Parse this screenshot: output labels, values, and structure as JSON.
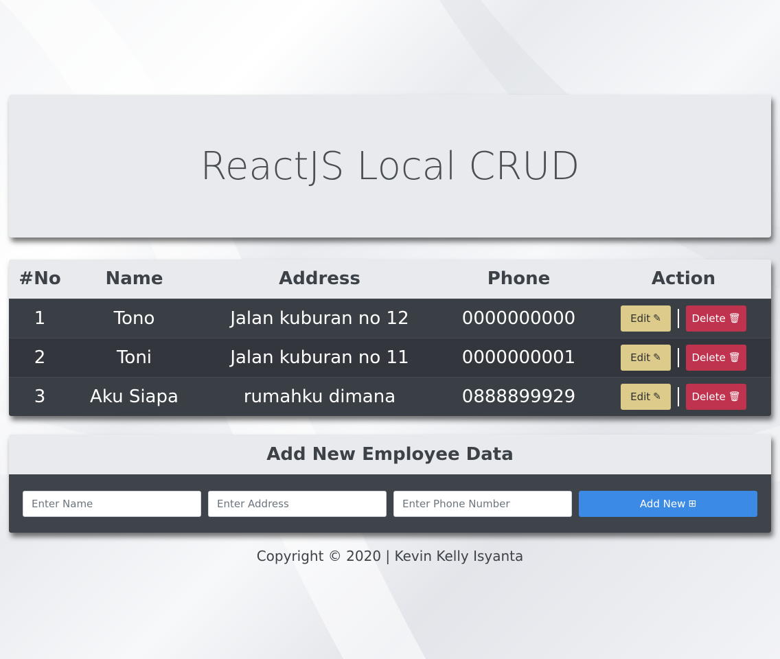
{
  "header": {
    "title": "ReactJS Local CRUD"
  },
  "table": {
    "columns": [
      "#No",
      "Name",
      "Address",
      "Phone",
      "Action"
    ],
    "rows": [
      {
        "no": "1",
        "name": "Tono",
        "address": "Jalan kuburan no 12",
        "phone": "0000000000"
      },
      {
        "no": "2",
        "name": "Toni",
        "address": "Jalan kuburan no 11",
        "phone": "0000000001"
      },
      {
        "no": "3",
        "name": "Aku Siapa",
        "address": "rumahku dimana",
        "phone": "0888899929"
      }
    ],
    "edit_label": "Edit",
    "delete_label": "Delete",
    "edit_icon": "edit-icon",
    "delete_icon": "trash-icon"
  },
  "form": {
    "title": "Add New Employee Data",
    "name_placeholder": "Enter Name",
    "address_placeholder": "Enter Address",
    "phone_placeholder": "Enter Phone Number",
    "add_label": "Add New",
    "add_icon": "plus-square-icon"
  },
  "footer": {
    "text": "Copyright © 2020 | Kevin Kelly Isyanta"
  },
  "colors": {
    "edit_button": "#dccb8a",
    "delete_button": "#c0334f",
    "add_button": "#3a8ae6",
    "table_dark": "#3a3f45",
    "header_light": "#e8eaed"
  }
}
